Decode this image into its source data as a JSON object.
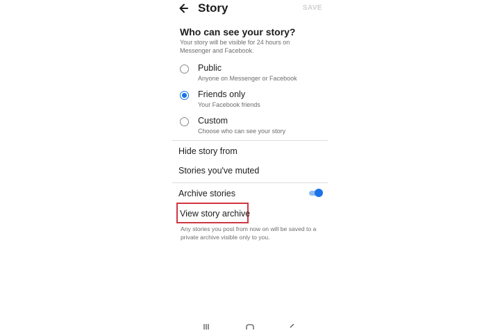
{
  "header": {
    "title": "Story",
    "save_label": "SAVE"
  },
  "audience": {
    "heading": "Who can see your story?",
    "description": "Your story will be visible for 24 hours on Messenger and Facebook.",
    "options": [
      {
        "label": "Public",
        "sub": "Anyone on Messenger or Facebook",
        "selected": false
      },
      {
        "label": "Friends only",
        "sub": "Your Facebook friends",
        "selected": true
      },
      {
        "label": "Custom",
        "sub": "Choose who can see your story",
        "selected": false
      }
    ]
  },
  "privacy": {
    "hide_story_from": "Hide story from",
    "muted": "Stories you've muted"
  },
  "archive": {
    "label": "Archive stories",
    "enabled": true,
    "view_label": "View story archive",
    "note": "Any stories you post from now on will be saved to a private archive visible only to you."
  },
  "colors": {
    "accent": "#1a73e8",
    "highlight": "#d03540"
  },
  "icons": {
    "back": "arrow-left-icon",
    "nav": [
      "recents-icon",
      "home-icon",
      "back-icon"
    ]
  }
}
